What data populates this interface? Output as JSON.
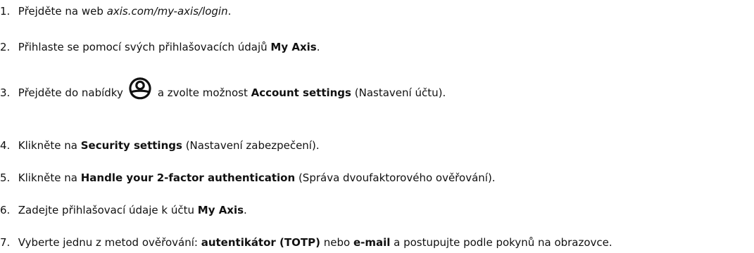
{
  "steps": [
    {
      "number": "1.",
      "parts": [
        "Přejděte na web ",
        "axis.com/my-axis/login",
        "."
      ]
    },
    {
      "number": "2.",
      "parts": [
        "Přihlaste se pomocí svých přihlašovacích údajů ",
        "My Axis",
        "."
      ]
    },
    {
      "number": "3.",
      "parts": [
        "Přejděte do nabídky",
        "a zvolte možnost ",
        "Account settings",
        " (Nastavení účtu)."
      ],
      "icon": "user-account-icon"
    },
    {
      "number": "4.",
      "parts": [
        "Klikněte na ",
        "Security settings",
        " (Nastavení zabezpečení)."
      ]
    },
    {
      "number": "5.",
      "parts": [
        "Klikněte na ",
        "Handle your 2-factor authentication",
        " (Správa dvoufaktorového ověřování)."
      ]
    },
    {
      "number": "6.",
      "parts": [
        "Zadejte přihlašovací údaje k účtu ",
        "My Axis",
        "."
      ]
    },
    {
      "number": "7.",
      "parts": [
        "Vyberte jednu z metod ověřování: ",
        "autentikátor (TOTP)",
        " nebo ",
        "e-mail",
        " a postupujte podle pokynů na obrazovce."
      ]
    }
  ]
}
